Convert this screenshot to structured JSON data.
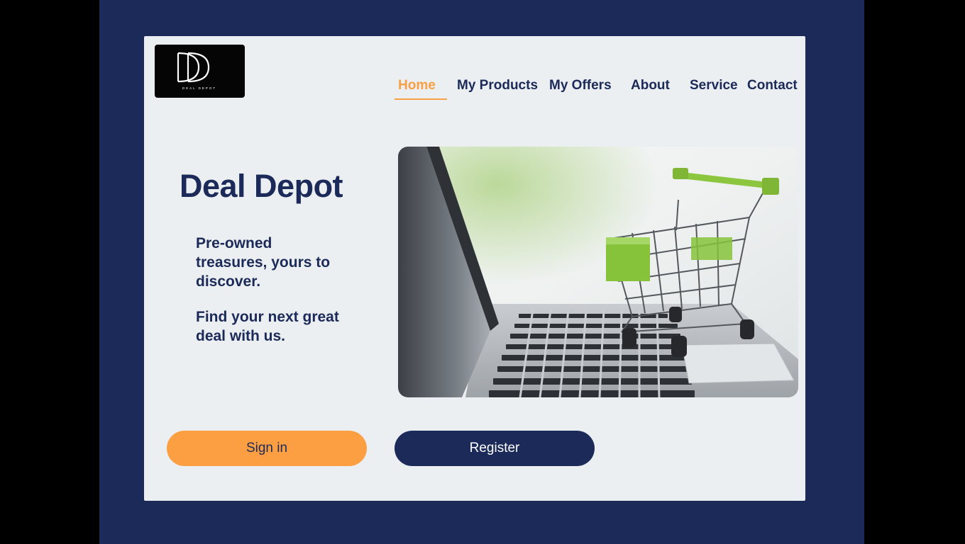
{
  "brand": {
    "logo_monogram": "DD",
    "logo_caption": "DEAL DEPOT"
  },
  "nav": {
    "items": [
      {
        "label": "Home",
        "active": true
      },
      {
        "label": "My Products",
        "active": false
      },
      {
        "label": "My Offers",
        "active": false
      },
      {
        "label": "About",
        "active": false
      },
      {
        "label": "Service",
        "active": false
      },
      {
        "label": "Contact",
        "active": false
      }
    ]
  },
  "hero": {
    "title": "Deal Depot",
    "tagline_1": "Pre-owned treasures, yours to discover.",
    "tagline_2": "Find your next great deal with us.",
    "image_icon": "shopping-cart-on-laptop-image"
  },
  "actions": {
    "signin_label": "Sign in",
    "register_label": "Register"
  },
  "colors": {
    "background_navy": "#1b2a58",
    "card": "#eceff1",
    "accent_orange": "#fb9f42",
    "text_navy": "#1b2a58"
  }
}
